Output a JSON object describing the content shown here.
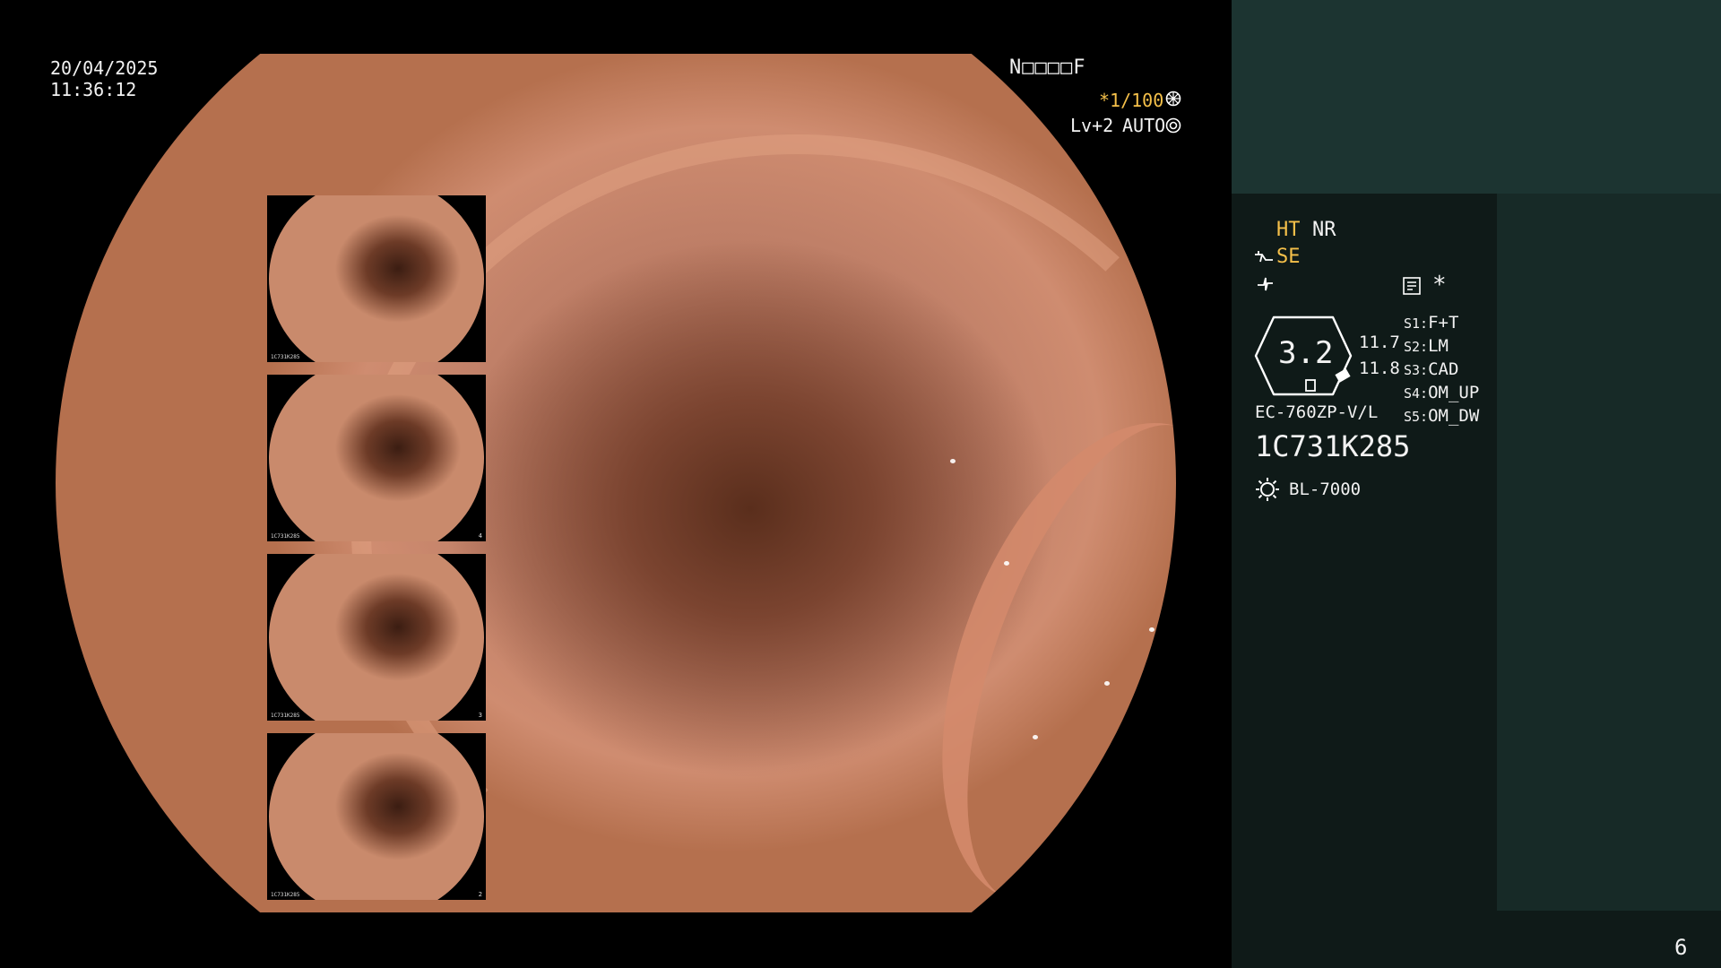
{
  "overlay": {
    "date": "20/04/2025",
    "time": "11:36:12",
    "status_code": "N□□□□F",
    "shutter": "*1/100",
    "level": "Lv+2",
    "iris_mode": "AUTO"
  },
  "panel": {
    "ht_label": "HT",
    "nr_label": "NR",
    "se_label": "SE",
    "zoom_value": "3.2",
    "value_a": "11.7",
    "value_b": "11.8",
    "scope_model": "EC-760ZP-V/L",
    "serial": "1C731K285",
    "light_source": "BL-7000",
    "asterisk": "*",
    "switch_settings": [
      {
        "key": "S1:",
        "value": "F+T"
      },
      {
        "key": "S2:",
        "value": "LM"
      },
      {
        "key": "S3:",
        "value": "CAD"
      },
      {
        "key": "S4:",
        "value": "OM_UP"
      },
      {
        "key": "S5:",
        "value": "OM_DW"
      }
    ],
    "page_number": "6"
  },
  "thumbnails": [
    {
      "info": "1C731K285",
      "number": ""
    },
    {
      "info": "1C731K285",
      "number": "4"
    },
    {
      "info": "1C731K285",
      "number": "3"
    },
    {
      "info": "1C731K285",
      "number": "2"
    }
  ],
  "icons": [
    "aperture-icon",
    "auto-iris-icon",
    "scope-tool-icon",
    "signal-icon",
    "memo-icon",
    "lamp-icon"
  ]
}
